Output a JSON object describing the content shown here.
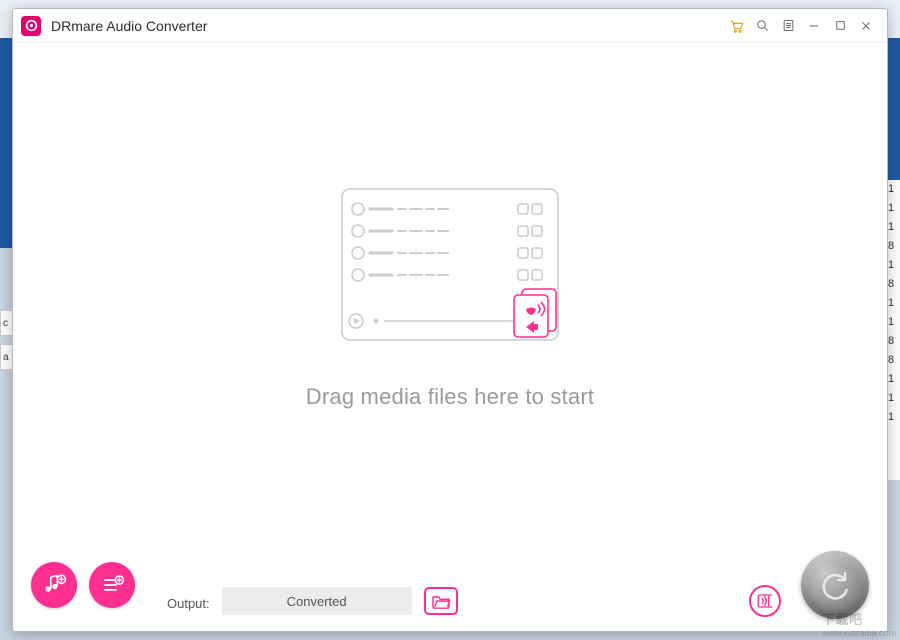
{
  "app": {
    "title": "DRmare Audio Converter"
  },
  "titlebar": {
    "icons": {
      "cart": "cart-icon",
      "search": "search-icon",
      "menu": "menu-icon",
      "minimize": "minimize-icon",
      "maximize": "maximize-icon",
      "close": "close-icon"
    }
  },
  "drop": {
    "text": "Drag media files here to start"
  },
  "bottom": {
    "output_label": "Output:",
    "output_folder": "Converted"
  },
  "background": {
    "right_strip": [
      "1",
      "1",
      "1",
      "8",
      "1",
      "8",
      "1",
      "1",
      "8",
      "8",
      "1",
      "1",
      "1"
    ]
  },
  "watermark": {
    "main": "下载吧",
    "sub": "www.xiazaiba.com"
  }
}
